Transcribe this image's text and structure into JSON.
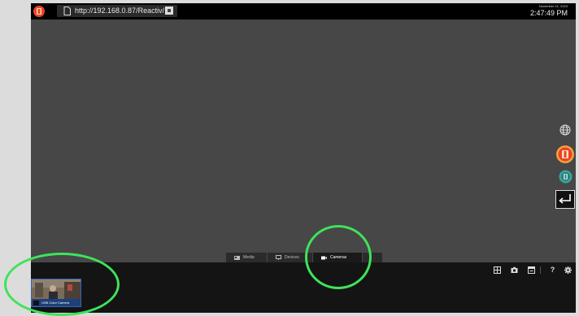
{
  "browser": {
    "url": "http://192.168.0.87/Reactiv/"
  },
  "clock": {
    "date": "November 21, 2023",
    "time": "2:47:49 PM"
  },
  "tabs": [
    {
      "label": "Media",
      "icon": "media-icon"
    },
    {
      "label": "Devices",
      "icon": "monitor-icon"
    },
    {
      "label": "Cameras",
      "icon": "camera-icon",
      "active": true
    }
  ],
  "sidebar_icons": [
    "globe-icon",
    "reactiv-logo-icon",
    "reactiv-alt-logo-icon",
    "return-icon"
  ],
  "toolbar_icons": [
    "grid-icon",
    "camera-snapshot-icon",
    "window-icon",
    "help-icon",
    "gear-icon"
  ],
  "toolbar": {
    "help_label": "?"
  },
  "thumbnail": {
    "label": "USB Color Camera"
  },
  "colors": {
    "highlight": "#3ee35a",
    "screen_bg": "#474747",
    "bar_bg": "#141414",
    "accent": "#e8432a"
  }
}
